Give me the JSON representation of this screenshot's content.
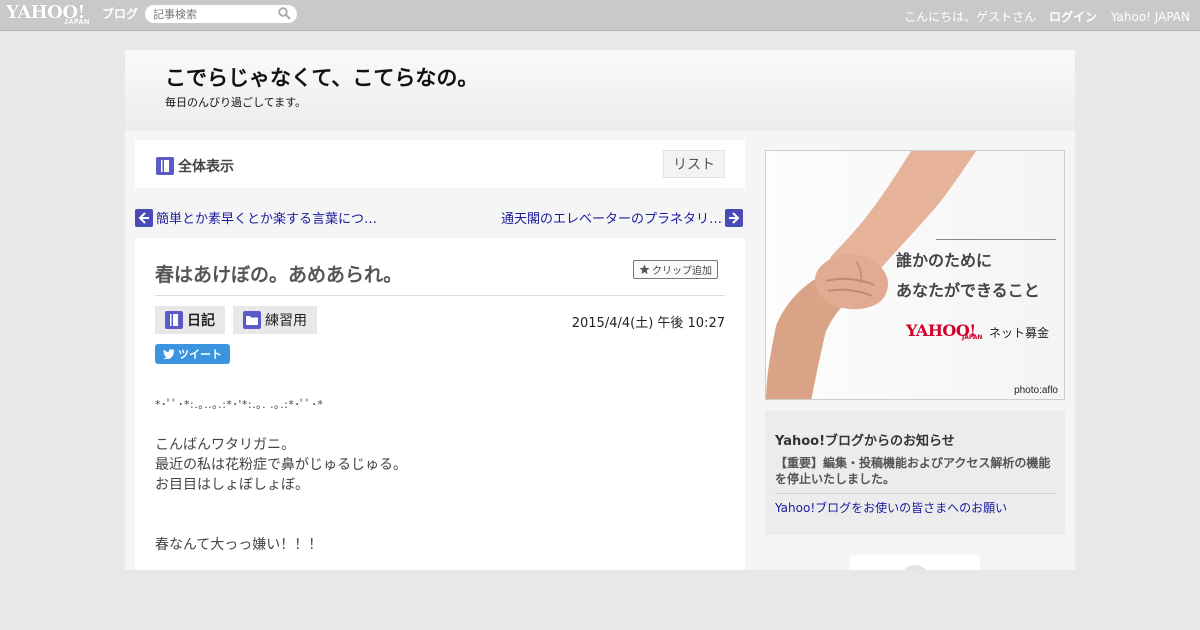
{
  "topbar": {
    "logo_yahoo": "YAHOO!",
    "logo_japan": "JAPAN",
    "logo_blog": "ブログ",
    "search_placeholder": "記事検索",
    "greeting": "こんにちは、ゲストさん",
    "login": "ログイン",
    "yahoo_japan": "Yahoo! JAPAN"
  },
  "blog": {
    "title": "こでらじゃなくて、こてらなの。",
    "subtitle": "毎日のんびり過ごしてます。"
  },
  "nav": {
    "view_all": "全体表示",
    "list": "リスト",
    "prev": "簡単とか素早くとか楽する言葉につ…",
    "next": "通天閣のエレベーターのプラネタリ…"
  },
  "article": {
    "title": "春はあけぼの。あめあられ。",
    "clip": "クリップ追加",
    "tag_diary": "日記",
    "tag_folder": "練習用",
    "date": "2015/4/4(土) 午後 10:27",
    "tweet": "ツイート",
    "body": [
      "*･ﾟﾟ･*:.｡..｡.:*･'*:.｡. .｡.:*･ﾟﾟ･*",
      "",
      "こんばんワタリガニ。",
      "最近の私は花粉症で鼻がじゅるじゅる。",
      "お目目はしょぼしょぼ。",
      "",
      "",
      "春なんて大っっ嫌い！！！"
    ]
  },
  "ad": {
    "line1": "誰かのために",
    "line2": "あなたができること",
    "logo": "YAHOO!",
    "logo_japan": "JAPAN",
    "service": "ネット募金",
    "credit": "photo:aflo"
  },
  "notice": {
    "title": "Yahoo!ブログからのお知らせ",
    "item1": "【重要】編集・投稿機能およびアクセス解析の機能を停止いたしました。",
    "item2": "Yahoo!ブログをお使いの皆さまへのお願い"
  },
  "colors": {
    "topbar": "#c9c9c9",
    "link": "#1a1a9e",
    "arrow": "#4a4ab8",
    "tweet": "#3a94e0",
    "ad_red": "#d3002c"
  }
}
